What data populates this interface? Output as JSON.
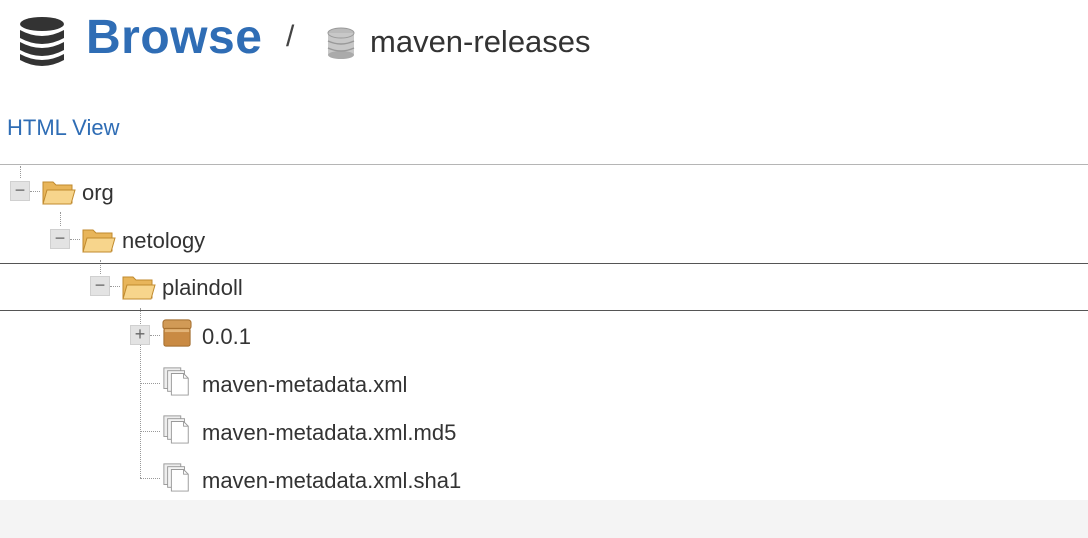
{
  "header": {
    "title": "Browse",
    "separator": "/",
    "repository": "maven-releases",
    "icon": "database-icon",
    "repo_icon": "repository-icon"
  },
  "view_link": "HTML View",
  "tree": [
    {
      "label": "org",
      "type": "folder-open",
      "expanded": true
    },
    {
      "label": "netology",
      "type": "folder-open",
      "expanded": true
    },
    {
      "label": "plaindoll",
      "type": "folder-open",
      "expanded": true,
      "selected": true
    },
    {
      "label": "0.0.1",
      "type": "component",
      "expanded": false
    },
    {
      "label": "maven-metadata.xml",
      "type": "asset"
    },
    {
      "label": "maven-metadata.xml.md5",
      "type": "asset"
    },
    {
      "label": "maven-metadata.xml.sha1",
      "type": "asset"
    }
  ],
  "colors": {
    "link": "#2f6db5",
    "text": "#333333",
    "folder": "#f2c46f"
  }
}
